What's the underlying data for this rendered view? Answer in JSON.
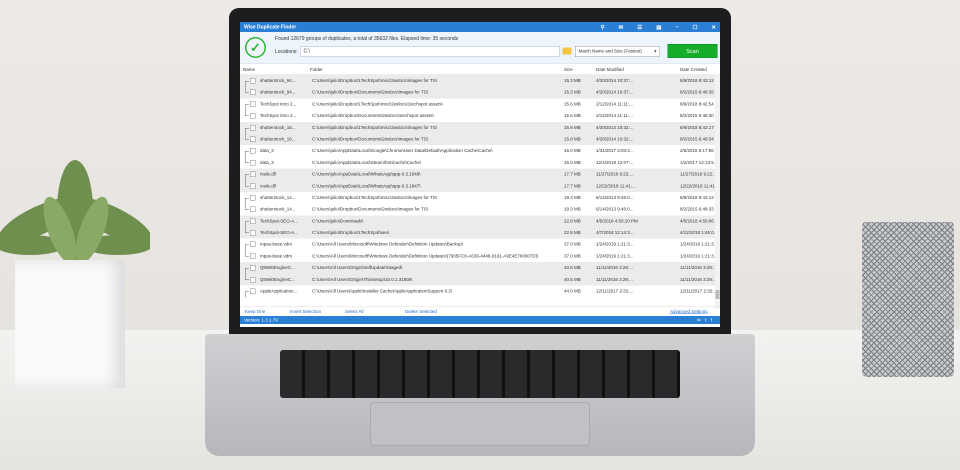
{
  "app": {
    "title": "Wise Duplicate Finder",
    "controls": [
      "⚲",
      "✉",
      "☰",
      "▤",
      "–",
      "☐",
      "✕"
    ],
    "summary": "Found 12679 groups of duplicates, a total of 35632 files. Elapsed time: 35 seconds",
    "location_label": "Locations:",
    "location_value": "C:\\",
    "match_mode": "Match Name and Size (Fastest)",
    "scan_label": "Scan",
    "columns": {
      "name": "Name",
      "folder": "Folder",
      "size": "Size",
      "modified": "Date Modified",
      "created": "Date Created"
    },
    "rows": [
      [
        "shutterstock_94...",
        "C:\\Users\\julio\\Dropbox\\1TechSpot\\misc\\2wdocs\\images for TS\\",
        "15.3 MB",
        "4/20/2014 10:37:...",
        "8/9/2018 8:43:12 ..."
      ],
      [
        "shutterstock_94...",
        "C:\\Users\\julio\\Dropbox\\Documents\\2wdocs\\images for TS\\",
        "15.3 MB",
        "4/20/2014 10:37:...",
        "8/2/2015 6:48:35 PM"
      ],
      [
        "TechSpot intro 2...",
        "C:\\Users\\julio\\Dropbox\\1TechSpot\\misc\\2wdocs\\1techspot assets\\",
        "15.6 MB",
        "2/12/2014 11:11:...",
        "8/9/2018 8:42:54 ..."
      ],
      [
        "TechSpot intro 2...",
        "C:\\Users\\julio\\Dropbox\\Documents\\2wdocs\\1techspot assets\\",
        "15.6 MB",
        "2/12/2014 11:11:...",
        "8/2/2015 6:48:30 PM"
      ],
      [
        "shutterstock_16...",
        "C:\\Users\\julio\\Dropbox\\1TechSpot\\misc\\2wdocs\\images for TS\\",
        "15.8 MB",
        "4/20/2014 10:32:...",
        "8/9/2018 8:43:17 ..."
      ],
      [
        "shutterstock_16...",
        "C:\\Users\\julio\\Dropbox\\Documents\\2wdocs\\images for TS\\",
        "15.8 MB",
        "4/20/2014 10:32:...",
        "8/2/2015 6:48:34 PM"
      ],
      [
        "data_3",
        "C:\\Users\\julio\\AppData\\Local\\Google\\Chrome\\User Data\\Default\\Application Cache\\Cache\\",
        "16.0 MB",
        "1/31/2017 3:03:4...",
        "2/5/2016 6:17:56 PM"
      ],
      [
        "data_3",
        "C:\\Users\\julio\\AppData\\Local\\Steam\\htmlcache\\Cache\\",
        "16.0 MB",
        "12/4/2018 12:07:...",
        "1/2/2017 12:13:5..."
      ],
      [
        "node.dll",
        "C:\\Users\\julio\\AppData\\Local\\WhatsApp\\app-0.3.1649\\",
        "17.7 MB",
        "11/27/2018 9:22:...",
        "11/27/2018 9:22:..."
      ],
      [
        "node.dll",
        "C:\\Users\\julio\\AppData\\Local\\WhatsApp\\app-0.3.1847\\",
        "17.7 MB",
        "12/22/2018 11:41:...",
        "12/22/2018 11:41:..."
      ],
      [
        "shutterstock_14...",
        "C:\\Users\\julio\\Dropbox\\1TechSpot\\misc\\2wdocs\\images for TS\\",
        "19.3 MB",
        "6/14/2013 9:46:0...",
        "8/9/2018 8:43:13 ..."
      ],
      [
        "shutterstock_14...",
        "C:\\Users\\julio\\Dropbox\\Documents\\2wdocs\\images for TS\\",
        "19.3 MB",
        "6/14/2013 9:46:0...",
        "8/2/2015 6:48:33 PM"
      ],
      [
        "TechSpot-SEO-A...",
        "C:\\Users\\julio\\Downloads\\",
        "22.8 MB",
        "4/5/2018 4:50:10 PM",
        "4/5/2018 4:50:06 PM"
      ],
      [
        "TechSpot-SEO-A...",
        "C:\\Users\\julio\\Dropbox\\1TechSpot\\seo\\",
        "22.8 MB",
        "4/7/2018 12:14:3...",
        "4/12/2018 1:46:0..."
      ],
      [
        "mpas-base.vdm",
        "C:\\Users\\All Users\\Microsoft\\Windows Defender\\Definition Updates\\Backup\\",
        "37.0 MB",
        "1/24/2019 1:21:3...",
        "1/24/2019 1:21:3..."
      ],
      [
        "mpas-base.vdm",
        "C:\\Users\\All Users\\Microsoft\\Windows Defender\\Definition Updates\\{7905FC8-A636-4448-9161-A9E4E760007D}\\",
        "37.0 MB",
        "1/24/2019 1:21:3...",
        "1/24/2019 1:21:3..."
      ],
      [
        "QtWebEngineC...",
        "C:\\Users\\All Users\\Origin\\SelfUpdate\\Staged\\",
        "40.5 MB",
        "11/11/2016 3:28:...",
        "11/11/2016 3:28:..."
      ],
      [
        "QtWebEngineC...",
        "C:\\Users\\All Users\\Origin\\ThinSetup\\10.0.1.31806\\",
        "40.5 MB",
        "11/11/2016 3:29:...",
        "11/11/2016 3:29:..."
      ],
      [
        "AppleApplication...",
        "C:\\Users\\All Users\\Apple\\Installer Cache\\AppleApplicationSupport 6.2\\",
        "44.0 MB",
        "12/11/2017 2:32:...",
        "12/11/2017 2:32:..."
      ]
    ],
    "links": {
      "keep_one": "Keep One",
      "invert": "Invert Selection",
      "select_all": "Select All",
      "delete": "Delete Selected",
      "advanced": "Advanced Settings"
    },
    "version": "Version: 1.3.1.79",
    "colors": {
      "accent": "#2a7fd4",
      "scan": "#15ad2a"
    }
  }
}
